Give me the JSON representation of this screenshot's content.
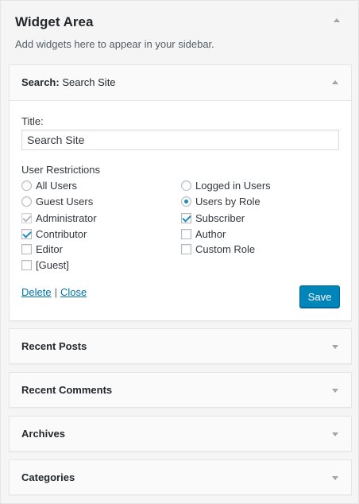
{
  "area": {
    "title": "Widget Area",
    "description": "Add widgets here to appear in your sidebar."
  },
  "search_widget": {
    "label": "Search:",
    "in_title": "Search Site",
    "title_label": "Title:",
    "title_value": "Search Site",
    "restrictions_label": "User Restrictions",
    "radios": [
      {
        "label": "All Users",
        "checked": false
      },
      {
        "label": "Logged in Users",
        "checked": false
      },
      {
        "label": "Guest Users",
        "checked": false
      },
      {
        "label": "Users by Role",
        "checked": true
      }
    ],
    "roles": [
      {
        "label": "Administrator",
        "checked": true,
        "disabled": true
      },
      {
        "label": "Subscriber",
        "checked": true,
        "disabled": false
      },
      {
        "label": "Contributor",
        "checked": true,
        "disabled": false
      },
      {
        "label": "Author",
        "checked": false,
        "disabled": false
      },
      {
        "label": "Editor",
        "checked": false,
        "disabled": false
      },
      {
        "label": "Custom Role",
        "checked": false,
        "disabled": false
      },
      {
        "label": "[Guest]",
        "checked": false,
        "disabled": false
      }
    ],
    "delete_label": "Delete",
    "separator": "|",
    "close_label": "Close",
    "save_label": "Save"
  },
  "closed_widgets": [
    {
      "title": "Recent Posts"
    },
    {
      "title": "Recent Comments"
    },
    {
      "title": "Archives"
    },
    {
      "title": "Categories"
    }
  ],
  "colors": {
    "accent": "#0085ba",
    "link": "#0073aa",
    "check": "#1e8cbe",
    "arrow": "#a0a5aa"
  },
  "icons": {
    "area_toggle": "triangle-up-icon",
    "open_arrow": "triangle-up-icon",
    "closed_arrow": "triangle-down-icon"
  }
}
